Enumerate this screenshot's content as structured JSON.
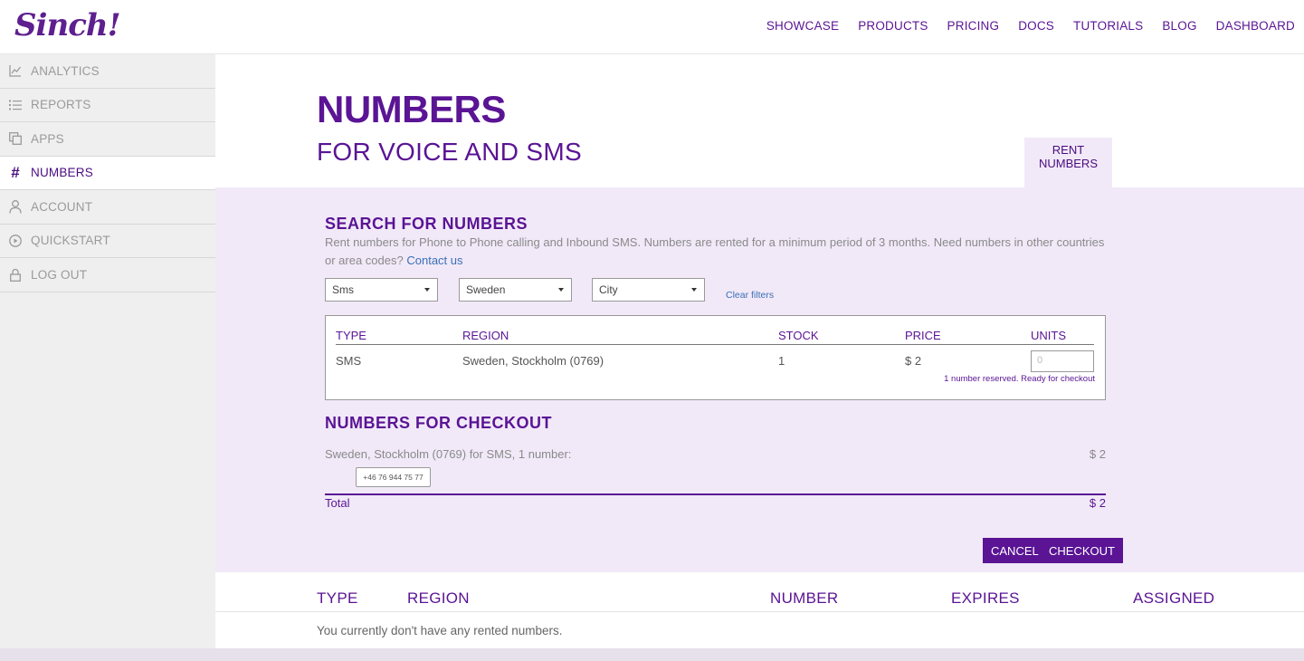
{
  "brand": {
    "logo_text": "Sinch!",
    "accent": "#5a1494",
    "panel_bg": "#f1e9f8"
  },
  "topnav": [
    {
      "label": "SHOWCASE"
    },
    {
      "label": "PRODUCTS"
    },
    {
      "label": "PRICING"
    },
    {
      "label": "DOCS"
    },
    {
      "label": "TUTORIALS"
    },
    {
      "label": "BLOG"
    },
    {
      "label": "DASHBOARD"
    }
  ],
  "sidebar": {
    "items": [
      {
        "label": "ANALYTICS",
        "icon": "chart-icon"
      },
      {
        "label": "REPORTS",
        "icon": "list-icon"
      },
      {
        "label": "APPS",
        "icon": "apps-icon"
      },
      {
        "label": "NUMBERS",
        "icon": "hash-icon",
        "active": true
      },
      {
        "label": "ACCOUNT",
        "icon": "user-icon"
      },
      {
        "label": "QUICKSTART",
        "icon": "play-icon"
      },
      {
        "label": "LOG OUT",
        "icon": "lock-icon"
      }
    ]
  },
  "page": {
    "title": "NUMBERS",
    "subtitle": "FOR VOICE AND SMS",
    "tab": "RENT NUMBERS"
  },
  "search": {
    "heading": "SEARCH FOR NUMBERS",
    "desc_text": "Rent numbers for Phone to Phone calling and Inbound SMS. Numbers are rented for a minimum period of 3 months. Need numbers in other countries or area codes?",
    "contact_link": "Contact us",
    "filters": {
      "type": "Sms",
      "country": "Sweden",
      "city": "City"
    },
    "clear_filters": "Clear filters"
  },
  "results": {
    "headers": {
      "type": "TYPE",
      "region": "REGION",
      "stock": "STOCK",
      "price": "PRICE",
      "units": "UNITS"
    },
    "row": {
      "type": "SMS",
      "region": "Sweden, Stockholm (0769)",
      "stock": "1",
      "price": "$ 2",
      "units_placeholder": "0"
    },
    "reserved_note": "1 number reserved. Ready for checkout"
  },
  "checkout": {
    "heading": "NUMBERS FOR CHECKOUT",
    "item_text": "Sweden, Stockholm (0769) for SMS, 1 number:",
    "item_price": "$ 2",
    "number_chip": "+46 76 944 75 77",
    "total_label": "Total",
    "total_price": "$ 2",
    "cancel_label": "CANCEL",
    "checkout_label": "CHECKOUT"
  },
  "rented": {
    "headers": {
      "type": "TYPE",
      "region": "REGION",
      "number": "NUMBER",
      "expires": "EXPIRES",
      "assigned": "ASSIGNED"
    },
    "empty_text": "You currently don't have any rented numbers."
  }
}
